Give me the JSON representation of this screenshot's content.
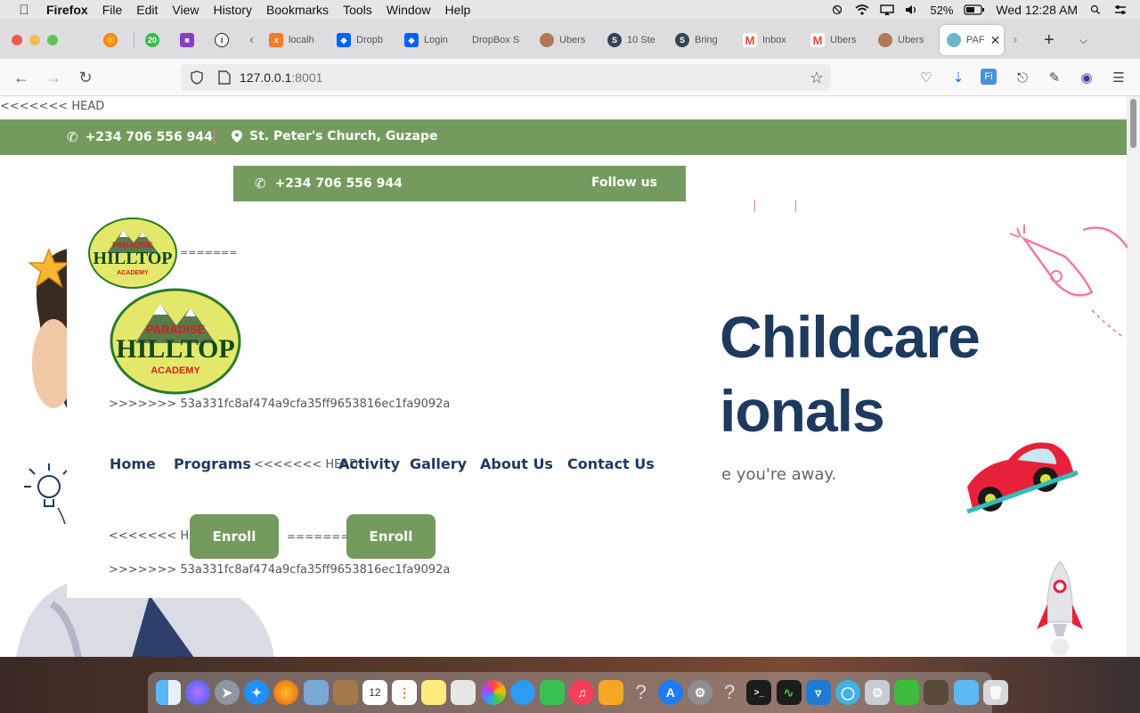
{
  "menubar": {
    "app": "Firefox",
    "items": [
      "File",
      "Edit",
      "View",
      "History",
      "Bookmarks",
      "Tools",
      "Window",
      "Help"
    ],
    "battery": "52%",
    "clock": "Wed 12:28 AM"
  },
  "tabs": [
    {
      "title": "",
      "icon": "firefox-icon",
      "color": "#e66000"
    },
    {
      "title": "",
      "icon": "green-badge-icon",
      "color": "#2fbf4a"
    },
    {
      "title": "",
      "icon": "robot-icon",
      "color": "#8a3cc8"
    },
    {
      "title": "",
      "icon": "info-icon",
      "color": "#222222"
    },
    {
      "title": "localh",
      "icon": "xampp-icon",
      "color": "#fb7a24"
    },
    {
      "title": "Dropb",
      "icon": "dropbox-icon",
      "color": "#0061fe"
    },
    {
      "title": "Login",
      "icon": "dropbox-icon",
      "color": "#0061fe"
    },
    {
      "title": "DropBox S",
      "icon": "",
      "color": ""
    },
    {
      "title": "Ubers",
      "icon": "avatar-icon",
      "color": "#b07a58"
    },
    {
      "title": "10 Ste",
      "icon": "s-icon",
      "color": "#334455"
    },
    {
      "title": "Bring",
      "icon": "s-icon",
      "color": "#334455"
    },
    {
      "title": "Inbox",
      "icon": "gmail-icon",
      "color": "#ea4335"
    },
    {
      "title": "Ubers",
      "icon": "gmail-icon",
      "color": "#ea4335"
    },
    {
      "title": "Ubers",
      "icon": "avatar-icon",
      "color": "#b07a58"
    },
    {
      "title": "PAF",
      "icon": "site-icon",
      "color": "#6ab7c7"
    }
  ],
  "url": {
    "host": "127.0.0.1",
    "port": ":8001"
  },
  "page": {
    "merge_head": "<<<<<<< HEAD",
    "merge_sep": "=======",
    "merge_tail": ">>>>>>> 53a331fc8af474a9cfa35ff9653816ec1fa9092a",
    "phone": "+234 706 556 944",
    "address": "St. Peter's Church, Guzape",
    "follow": "Follow us",
    "logo_top": "PARADISE",
    "logo_main": "HILLTOP",
    "logo_bottom": "ACADEMY",
    "nav": [
      "Home",
      "Programs",
      "Activity",
      "Gallery",
      "About Us",
      "Contact Us"
    ],
    "enroll": "Enroll",
    "hero_line1": "Childcare",
    "hero_line2": "ionals",
    "hero_sub": "e you're away."
  },
  "dock": {
    "calendar_day": "12",
    "items": [
      "finder-icon",
      "siri-icon",
      "launchpad-icon",
      "safari-icon",
      "firefox-icon",
      "preview-icon",
      "book-icon",
      "calendar-icon",
      "reminders-icon",
      "notes-icon",
      "photos-icon",
      "messages-icon",
      "facetime-icon",
      "music-icon",
      "books-icon",
      "help-icon",
      "appstore-icon",
      "settings-icon",
      "help-icon",
      "terminal-icon",
      "activity-icon",
      "vscode-icon",
      "circle-icon",
      "settings2-icon",
      "green-icon",
      "photo-icon",
      "folder-icon",
      "trash-icon"
    ]
  },
  "colors": {
    "green": "#749b5d",
    "navy": "#1e3a5f",
    "pink": "#f47a9b"
  }
}
